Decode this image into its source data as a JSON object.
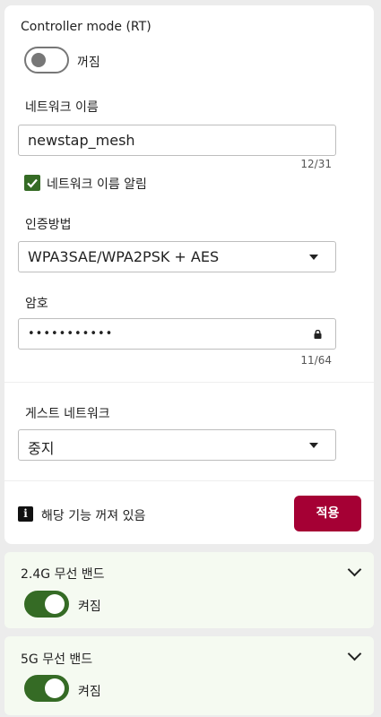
{
  "controller_mode": {
    "label": "Controller mode (RT)",
    "state": "꺼짐",
    "enabled": false
  },
  "network_name": {
    "label": "네트워크 이름",
    "value": "newstap_mesh",
    "counter": "12/31"
  },
  "broadcast": {
    "label": "네트워크 이름 알림",
    "checked": true
  },
  "auth": {
    "label": "인증방법",
    "value": "WPA3SAE/WPA2PSK + AES"
  },
  "password": {
    "label": "암호",
    "value": "•••••••••••",
    "counter": "11/64"
  },
  "guest": {
    "label": "게스트 네트워크",
    "value": "중지"
  },
  "footer": {
    "info_text": "해당 기능 꺼져 있음",
    "apply_label": "적용"
  },
  "bands": [
    {
      "title": "2.4G 무선 밴드",
      "state": "켜짐",
      "enabled": true
    },
    {
      "title": "5G 무선 밴드",
      "state": "켜짐",
      "enabled": true
    }
  ],
  "colors": {
    "accent_green": "#356b25",
    "apply_button": "#a50034",
    "band_bg": "#f5faf1"
  }
}
